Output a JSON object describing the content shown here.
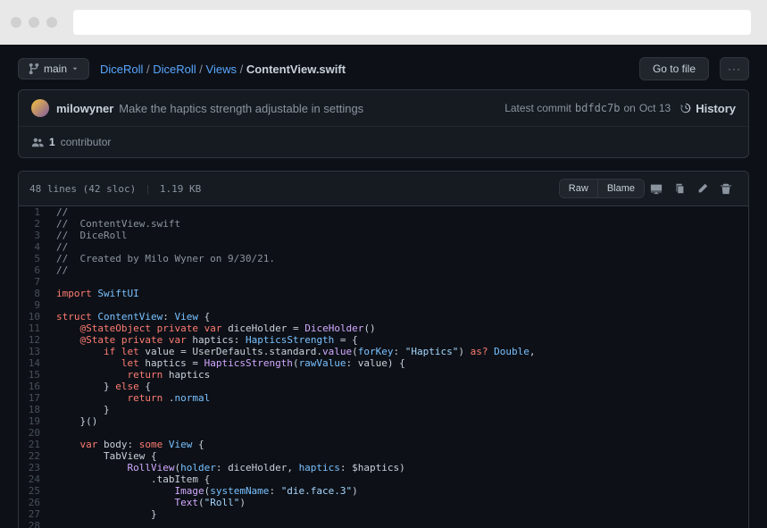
{
  "branch": {
    "label": "main"
  },
  "breadcrumb": {
    "parts": [
      "DiceRoll",
      "DiceRoll",
      "Views"
    ],
    "file": "ContentView.swift",
    "sep": " / "
  },
  "buttons": {
    "goto_file": "Go to file",
    "more": "···",
    "raw": "Raw",
    "blame": "Blame"
  },
  "commit": {
    "author": "milowyner",
    "message": "Make the haptics strength adjustable in settings",
    "latest_label": "Latest commit",
    "hash": "bdfdc7b",
    "date_prefix": "on",
    "date": "Oct 13",
    "history_label": "History"
  },
  "contributors": {
    "count": "1",
    "label": "contributor"
  },
  "file_meta": {
    "lines": "48 lines (42 sloc)",
    "size": "1.19 KB"
  },
  "code_lines": [
    [
      [
        "comment",
        "//"
      ]
    ],
    [
      [
        "comment",
        "//  ContentView.swift"
      ]
    ],
    [
      [
        "comment",
        "//  DiceRoll"
      ]
    ],
    [
      [
        "comment",
        "//"
      ]
    ],
    [
      [
        "comment",
        "//  Created by Milo Wyner on 9/30/21."
      ]
    ],
    [
      [
        "comment",
        "//"
      ]
    ],
    [],
    [
      [
        "keyword",
        "import"
      ],
      [
        "plain",
        " "
      ],
      [
        "type",
        "SwiftUI"
      ]
    ],
    [],
    [
      [
        "keyword",
        "struct"
      ],
      [
        "plain",
        " "
      ],
      [
        "type",
        "ContentView"
      ],
      [
        "plain",
        ": "
      ],
      [
        "type",
        "View"
      ],
      [
        "plain",
        " {"
      ]
    ],
    [
      [
        "plain",
        "    "
      ],
      [
        "keyword",
        "@StateObject"
      ],
      [
        "plain",
        " "
      ],
      [
        "keyword",
        "private"
      ],
      [
        "plain",
        " "
      ],
      [
        "keyword",
        "var"
      ],
      [
        "plain",
        " diceHolder "
      ],
      [
        "plain",
        "= "
      ],
      [
        "func",
        "DiceHolder"
      ],
      [
        "plain",
        "()"
      ]
    ],
    [
      [
        "plain",
        "    "
      ],
      [
        "keyword",
        "@State"
      ],
      [
        "plain",
        " "
      ],
      [
        "keyword",
        "private"
      ],
      [
        "plain",
        " "
      ],
      [
        "keyword",
        "var"
      ],
      [
        "plain",
        " haptics: "
      ],
      [
        "type",
        "HapticsStrength"
      ],
      [
        "plain",
        " = {"
      ]
    ],
    [
      [
        "plain",
        "        "
      ],
      [
        "keyword",
        "if"
      ],
      [
        "plain",
        " "
      ],
      [
        "keyword",
        "let"
      ],
      [
        "plain",
        " value = UserDefaults.standard."
      ],
      [
        "func",
        "value"
      ],
      [
        "plain",
        "("
      ],
      [
        "prop",
        "forKey"
      ],
      [
        "plain",
        ": "
      ],
      [
        "string",
        "\"Haptics\""
      ],
      [
        "plain",
        ") "
      ],
      [
        "keyword",
        "as?"
      ],
      [
        "plain",
        " "
      ],
      [
        "type",
        "Double"
      ],
      [
        "plain",
        ","
      ]
    ],
    [
      [
        "plain",
        "           "
      ],
      [
        "keyword",
        "let"
      ],
      [
        "plain",
        " haptics = "
      ],
      [
        "func",
        "HapticsStrength"
      ],
      [
        "plain",
        "("
      ],
      [
        "prop",
        "rawValue"
      ],
      [
        "plain",
        ": value) {"
      ]
    ],
    [
      [
        "plain",
        "            "
      ],
      [
        "keyword",
        "return"
      ],
      [
        "plain",
        " haptics"
      ]
    ],
    [
      [
        "plain",
        "        } "
      ],
      [
        "keyword",
        "else"
      ],
      [
        "plain",
        " {"
      ]
    ],
    [
      [
        "plain",
        "            "
      ],
      [
        "keyword",
        "return"
      ],
      [
        "plain",
        " ."
      ],
      [
        "prop",
        "normal"
      ]
    ],
    [
      [
        "plain",
        "        }"
      ]
    ],
    [
      [
        "plain",
        "    }()"
      ]
    ],
    [],
    [
      [
        "plain",
        "    "
      ],
      [
        "keyword",
        "var"
      ],
      [
        "plain",
        " body: "
      ],
      [
        "keyword",
        "some"
      ],
      [
        "plain",
        " "
      ],
      [
        "type",
        "View"
      ],
      [
        "plain",
        " {"
      ]
    ],
    [
      [
        "plain",
        "        TabView {"
      ]
    ],
    [
      [
        "plain",
        "            "
      ],
      [
        "func",
        "RollView"
      ],
      [
        "plain",
        "("
      ],
      [
        "prop",
        "holder"
      ],
      [
        "plain",
        ": diceHolder, "
      ],
      [
        "prop",
        "haptics"
      ],
      [
        "plain",
        ": $haptics)"
      ]
    ],
    [
      [
        "plain",
        "                .tabItem {"
      ]
    ],
    [
      [
        "plain",
        "                    "
      ],
      [
        "func",
        "Image"
      ],
      [
        "plain",
        "("
      ],
      [
        "prop",
        "systemName"
      ],
      [
        "plain",
        ": "
      ],
      [
        "string",
        "\"die.face.3\""
      ],
      [
        "plain",
        ")"
      ]
    ],
    [
      [
        "plain",
        "                    "
      ],
      [
        "func",
        "Text"
      ],
      [
        "plain",
        "("
      ],
      [
        "string",
        "\"Roll\""
      ],
      [
        "plain",
        ")"
      ]
    ],
    [
      [
        "plain",
        "                }"
      ]
    ],
    []
  ]
}
